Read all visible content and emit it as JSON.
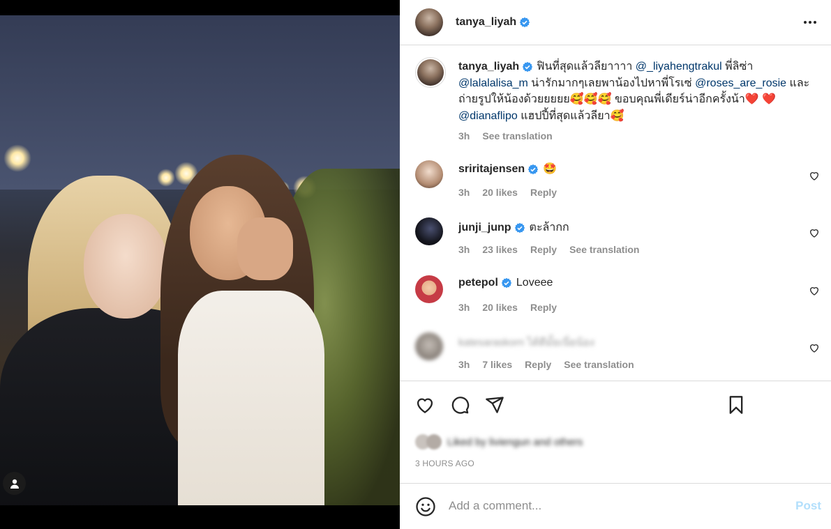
{
  "post": {
    "author": "tanya_liyah",
    "time_ago_label": "3 HOURS AGO"
  },
  "caption": {
    "author": "tanya_liyah",
    "part1": "ฟินที่สุดแล้วลียาาาา ",
    "mention1": "@_liyahengtrakul",
    "part2": " พี่ลิซ่า ",
    "mention2": "@lalalalisa_m",
    "part3": " น่ารักมากๆเลยพาน้องไปหาพี่โรเซ่ ",
    "mention3": "@roses_are_rosie",
    "part4": " และถ่ายรูปให้น้องด้วยยยยย🥰🥰🥰 ขอบคุณพี่เดียร์น่าอีกครั้งน้า❤️ ❤️ ",
    "mention4": "@dianaflipo",
    "part5": " แฮปปี้ที่สุดแล้วลียา🥰",
    "time": "3h",
    "see_translation": "See translation"
  },
  "comments": [
    {
      "user": "sriritajensen",
      "text": "🤩",
      "time": "3h",
      "likes": "20 likes",
      "reply": "Reply",
      "translate": ""
    },
    {
      "user": "junji_junp",
      "text": "ตะล้ากก",
      "time": "3h",
      "likes": "23 likes",
      "reply": "Reply",
      "translate": "See translation"
    },
    {
      "user": "petepol",
      "text": "Loveee",
      "time": "3h",
      "likes": "20 likes",
      "reply": "Reply",
      "translate": ""
    },
    {
      "user": "katesaraskorn",
      "text": "ได้ดีมั้ยเนี่ยน้อง",
      "time": "3h",
      "likes": "7 likes",
      "reply": "Reply",
      "translate": "See translation"
    }
  ],
  "likes": {
    "text": "Liked by liviengun and others"
  },
  "add_comment": {
    "placeholder": "Add a comment...",
    "post_label": "Post"
  },
  "colors": {
    "link": "#00376b",
    "verified": "#3897f0",
    "muted": "#8e8e8e",
    "post_disabled": "#b2dffc"
  }
}
